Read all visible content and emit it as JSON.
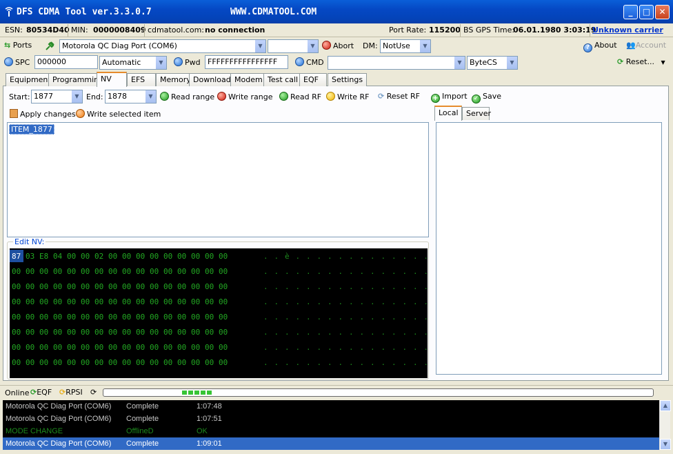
{
  "window": {
    "title": "DFS CDMA Tool ver.3.3.0.7",
    "url": "WWW.CDMATOOL.COM"
  },
  "info": {
    "esn_label": "ESN:",
    "esn": "80534D40",
    "min_label": "MIN:",
    "min": "0000008409",
    "site_label": "cdmatool.com:",
    "site_status": "no connection",
    "port_rate_label": "Port Rate:",
    "port_rate": "115200",
    "gps_label": "BS GPS Time:",
    "gps_time": "06.01.1980 3:03:19",
    "carrier": "Unknown carrier"
  },
  "toolbar1": {
    "ports_label": "Ports",
    "port_value": "Motorola QC Diag Port (COM6)",
    "second_value": "",
    "abort_label": "Abort",
    "dm_label": "DM:",
    "dm_value": "NotUse",
    "about_label": "About",
    "account_label": "Account"
  },
  "toolbar2": {
    "spc_label": "SPC",
    "spc_value": "000000",
    "mode_value": "Automatic",
    "pwd_label": "Pwd",
    "pwd_value": "FFFFFFFFFFFFFFFF",
    "cmd_label": "CMD",
    "cmd_value": "",
    "encoding_value": "ByteCS",
    "reset_label": "Reset..."
  },
  "tabs": [
    "Equipment",
    "Programming",
    "NV",
    "EFS",
    "Memory",
    "Download",
    "Modem",
    "Test call",
    "EQF",
    "Settings"
  ],
  "active_tab": "NV",
  "nv": {
    "start_label": "Start:",
    "start_value": "1877",
    "end_label": "End:",
    "end_value": "1878",
    "read_range": "Read range",
    "write_range": "Write range",
    "read_rf": "Read RF",
    "write_rf": "Write RF",
    "reset_rf": "Reset RF",
    "import": "Import",
    "save": "Save",
    "apply": "Apply changes",
    "write_selected": "Write selected item",
    "items": [
      "ITEM_1877"
    ],
    "edit_legend": "Edit NV:"
  },
  "hex": {
    "rows": [
      {
        "bytes": [
          "87",
          "03",
          "E8",
          "04",
          "00",
          "00",
          "02",
          "00",
          "00",
          "00",
          "00",
          "00",
          "00",
          "00",
          "00",
          "00"
        ],
        "ascii": [
          ".",
          ".",
          "è",
          ".",
          ".",
          ".",
          ".",
          ".",
          ".",
          ".",
          ".",
          ".",
          ".",
          ".",
          ".",
          "."
        ]
      },
      {
        "bytes": [
          "00",
          "00",
          "00",
          "00",
          "00",
          "00",
          "00",
          "00",
          "00",
          "00",
          "00",
          "00",
          "00",
          "00",
          "00",
          "00"
        ],
        "ascii": [
          ".",
          ".",
          ".",
          ".",
          ".",
          ".",
          ".",
          ".",
          ".",
          ".",
          ".",
          ".",
          ".",
          ".",
          ".",
          "."
        ]
      },
      {
        "bytes": [
          "00",
          "00",
          "00",
          "00",
          "00",
          "00",
          "00",
          "00",
          "00",
          "00",
          "00",
          "00",
          "00",
          "00",
          "00",
          "00"
        ],
        "ascii": [
          ".",
          ".",
          ".",
          ".",
          ".",
          ".",
          ".",
          ".",
          ".",
          ".",
          ".",
          ".",
          ".",
          ".",
          ".",
          "."
        ]
      },
      {
        "bytes": [
          "00",
          "00",
          "00",
          "00",
          "00",
          "00",
          "00",
          "00",
          "00",
          "00",
          "00",
          "00",
          "00",
          "00",
          "00",
          "00"
        ],
        "ascii": [
          ".",
          ".",
          ".",
          ".",
          ".",
          ".",
          ".",
          ".",
          ".",
          ".",
          ".",
          ".",
          ".",
          ".",
          ".",
          "."
        ]
      },
      {
        "bytes": [
          "00",
          "00",
          "00",
          "00",
          "00",
          "00",
          "00",
          "00",
          "00",
          "00",
          "00",
          "00",
          "00",
          "00",
          "00",
          "00"
        ],
        "ascii": [
          ".",
          ".",
          ".",
          ".",
          ".",
          ".",
          ".",
          ".",
          ".",
          ".",
          ".",
          ".",
          ".",
          ".",
          ".",
          "."
        ]
      },
      {
        "bytes": [
          "00",
          "00",
          "00",
          "00",
          "00",
          "00",
          "00",
          "00",
          "00",
          "00",
          "00",
          "00",
          "00",
          "00",
          "00",
          "00"
        ],
        "ascii": [
          ".",
          ".",
          ".",
          ".",
          ".",
          ".",
          ".",
          ".",
          ".",
          ".",
          ".",
          ".",
          ".",
          ".",
          ".",
          "."
        ]
      },
      {
        "bytes": [
          "00",
          "00",
          "00",
          "00",
          "00",
          "00",
          "00",
          "00",
          "00",
          "00",
          "00",
          "00",
          "00",
          "00",
          "00",
          "00"
        ],
        "ascii": [
          ".",
          ".",
          ".",
          ".",
          ".",
          ".",
          ".",
          ".",
          ".",
          ".",
          ".",
          ".",
          ".",
          ".",
          ".",
          "."
        ]
      },
      {
        "bytes": [
          "00",
          "00",
          "00",
          "00",
          "00",
          "00",
          "00",
          "00",
          "00",
          "00",
          "00",
          "00",
          "00",
          "00",
          "00",
          "00"
        ],
        "ascii": [
          ".",
          ".",
          ".",
          ".",
          ".",
          ".",
          ".",
          ".",
          ".",
          ".",
          ".",
          ".",
          ".",
          ".",
          ".",
          "."
        ]
      }
    ]
  },
  "right_tabs": [
    "Local",
    "Server"
  ],
  "status": {
    "online": "Online",
    "eqf": "EQF",
    "rpsi": "RPSI",
    "progress_segments": 5
  },
  "log": [
    {
      "port": "Motorola QC Diag Port (COM6)",
      "status": "Complete",
      "time": "1:07:48"
    },
    {
      "port": "Motorola QC Diag Port (COM6)",
      "status": "Complete",
      "time": "1:07:51"
    },
    {
      "port": "MODE CHANGE",
      "status": "OfflineD",
      "time": "OK"
    },
    {
      "port": "Motorola QC Diag Port (COM6)",
      "status": "Complete",
      "time": "1:09:01"
    }
  ]
}
